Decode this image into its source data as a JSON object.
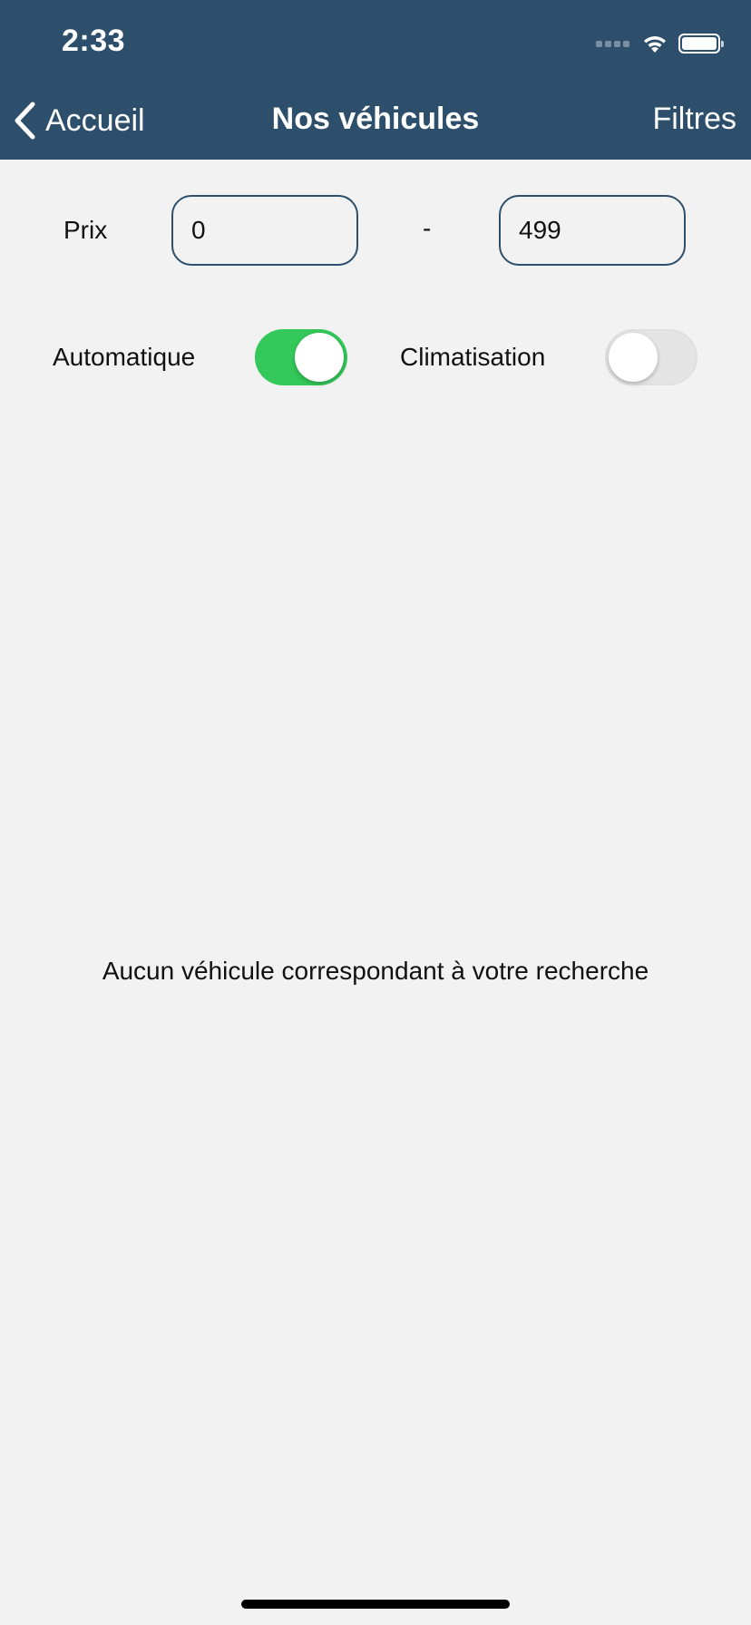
{
  "status_bar": {
    "time": "2:33",
    "icons": [
      "signal-icon",
      "wifi-icon",
      "battery-icon"
    ]
  },
  "nav": {
    "back_label": "Accueil",
    "title": "Nos véhicules",
    "filters_label": "Filtres",
    "back_icon": "chevron-left-icon"
  },
  "filters": {
    "price_label": "Prix",
    "price_min": "0",
    "price_separator": "-",
    "price_max": "499",
    "automatic_label": "Automatique",
    "automatic_on": true,
    "air_conditioning_label": "Climatisation",
    "air_conditioning_on": false
  },
  "results": {
    "empty_message": "Aucun véhicule correspondant à votre recherche"
  },
  "colors": {
    "header_background": "#2d4f6c",
    "page_background": "#f2f2f2",
    "toggle_on": "#34c759",
    "toggle_off": "#e4e4e4"
  }
}
